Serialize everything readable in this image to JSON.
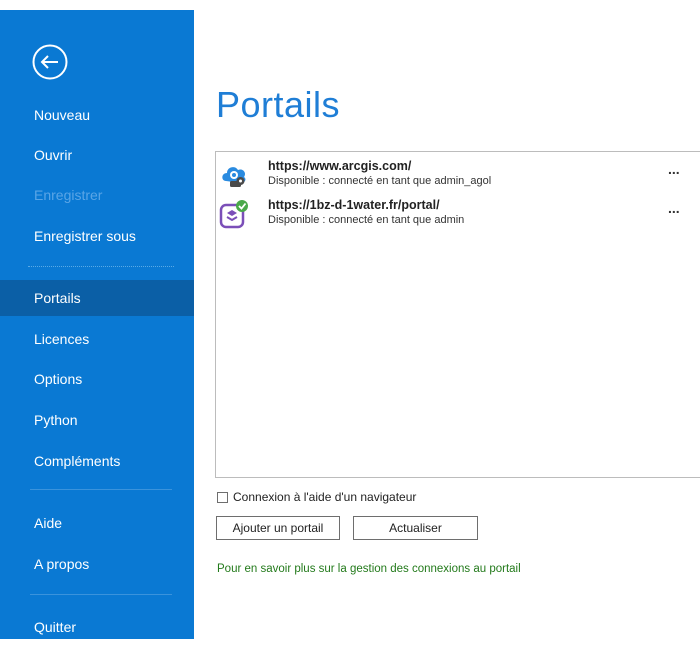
{
  "sidebar": {
    "back_icon": "back-arrow-circle-icon",
    "items": [
      {
        "label": "Nouveau",
        "state": "normal"
      },
      {
        "label": "Ouvrir",
        "state": "normal"
      },
      {
        "label": "Enregistrer",
        "state": "disabled"
      },
      {
        "label": "Enregistrer sous",
        "state": "normal"
      },
      {
        "label": "Portails",
        "state": "selected"
      },
      {
        "label": "Licences",
        "state": "normal"
      },
      {
        "label": "Options",
        "state": "normal"
      },
      {
        "label": "Python",
        "state": "normal"
      },
      {
        "label": "Compléments",
        "state": "normal"
      },
      {
        "label": "Aide",
        "state": "normal"
      },
      {
        "label": "A propos",
        "state": "normal"
      },
      {
        "label": "Quitter",
        "state": "normal"
      }
    ]
  },
  "main": {
    "title": "Portails",
    "portals": [
      {
        "url": "https://www.arcgis.com/",
        "status": "Disponible : connecté en tant que admin_agol",
        "icon": "arcgis-online-cloud-key-icon",
        "more": "..."
      },
      {
        "url": "https://1bz-d-1water.fr/portal/",
        "status": "Disponible : connecté en tant que admin",
        "icon": "enterprise-portal-active-icon",
        "more": "..."
      }
    ],
    "browser_login_label": "Connexion à l'aide d'un navigateur",
    "browser_login_checked": false,
    "add_portal_label": "Ajouter un portail",
    "refresh_label": "Actualiser",
    "learn_more_link": "Pour en savoir plus sur la gestion des connexions au portail"
  },
  "colors": {
    "sidebar_bg": "#0a79d3",
    "sidebar_selected": "#0b5fa6",
    "title": "#1f7ed6",
    "link": "#237a1b"
  }
}
